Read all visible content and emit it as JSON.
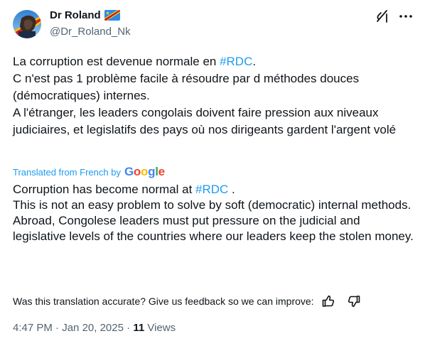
{
  "author": {
    "display_name": "Dr Roland",
    "handle": "@Dr_Roland_Nk"
  },
  "tweet": {
    "original": {
      "line1_pre": "La corruption est devenue normale en ",
      "line1_hashtag": "#RDC",
      "line1_post": ".",
      "para2": "C n'est pas 1 problème facile à résoudre par d méthodes douces (démocratiques) internes.",
      "para3": "A l'étranger, les leaders congolais doivent faire pression aux niveaux judiciaires, et legislatifs des pays où nos dirigeants gardent l'argent volé"
    },
    "translation_label": "Translated from French by",
    "translation_provider": "Google",
    "translation": {
      "line1_pre": "Corruption has become normal at ",
      "line1_hashtag": "#RDC",
      "line1_post": " .",
      "para2": "This is not an easy problem to solve by soft (democratic) internal methods.",
      "para3": "Abroad, Congolese leaders must put pressure on the judicial and legislative levels of the countries where our leaders keep the stolen money."
    },
    "feedback_prompt": "Was this translation accurate? Give us feedback so we can improve:",
    "time": "4:47 PM",
    "separator": "·",
    "date": "Jan 20, 2025",
    "views_count": "11",
    "views_label": "Views"
  },
  "icons": {
    "verified_flag": "drc-flag-icon",
    "grok": "grok-icon",
    "more": "more-icon",
    "thumbs_up": "thumbs-up-icon",
    "thumbs_down": "thumbs-down-icon"
  },
  "colors": {
    "accent": "#1d9bf0",
    "text": "#0f1419",
    "secondary": "#536471"
  }
}
